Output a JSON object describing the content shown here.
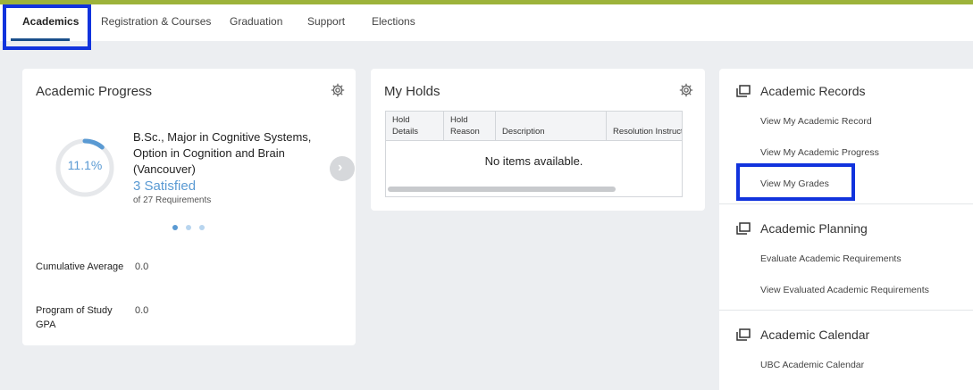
{
  "tabs": [
    {
      "label": "Academics"
    },
    {
      "label": "Registration & Courses"
    },
    {
      "label": "Graduation"
    },
    {
      "label": "Support"
    },
    {
      "label": "Elections"
    }
  ],
  "progress": {
    "title": "Academic Progress",
    "percent_label": "11.1%",
    "percent_value": 11.1,
    "program": "B.Sc., Major in Cognitive Systems, Option in Cognition and Brain (Vancouver)",
    "satisfied": "3 Satisfied",
    "requirements": "of 27 Requirements",
    "metrics": [
      {
        "label": "Cumulative Average",
        "value": "0.0"
      },
      {
        "label": "Program of Study GPA",
        "value": "0.0"
      }
    ]
  },
  "holds": {
    "title": "My Holds",
    "columns": [
      "Hold Details",
      "Hold Reason",
      "Description",
      "Resolution Instructions"
    ],
    "empty_message": "No items available."
  },
  "academic_records": {
    "title": "Academic Records",
    "links": [
      "View My Academic Record",
      "View My Academic Progress",
      "View My Grades"
    ]
  },
  "academic_planning": {
    "title": "Academic Planning",
    "links": [
      "Evaluate Academic Requirements",
      "View Evaluated Academic Requirements"
    ]
  },
  "academic_calendar": {
    "title": "Academic Calendar",
    "links": [
      "UBC Academic Calendar"
    ]
  },
  "icons": {
    "settings": "gear-icon",
    "next": "chevron-right-icon",
    "section": "stacked-windows-icon"
  },
  "colors": {
    "accent": "#5a9ad3",
    "top_bar": "#9db33b",
    "highlight": "#1133dd"
  }
}
